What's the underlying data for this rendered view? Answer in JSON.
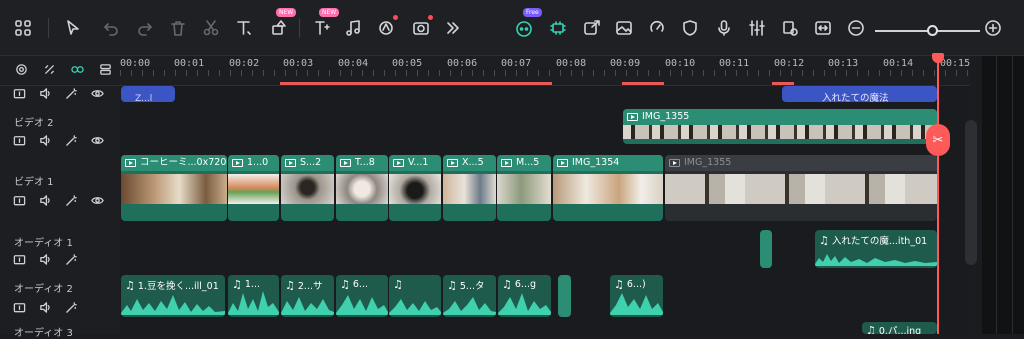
{
  "toolbar": {
    "badges": {
      "new1": "NEW",
      "new2": "NEW",
      "free": "Free"
    },
    "icons": [
      "grid-icon",
      "pointer-icon",
      "undo-icon",
      "redo-icon",
      "delete-icon",
      "cut-icon",
      "text-icon",
      "crop-icon",
      "text-effect-icon",
      "music-plus-icon",
      "auto-icon",
      "camera-icon",
      "more-icon",
      "ai-copilot-icon",
      "chip-icon",
      "export-frame-icon",
      "image-icon",
      "speed-icon",
      "shield-icon",
      "microphone-icon",
      "mixer-icon",
      "preview-icon",
      "fit-icon",
      "zoom-out-icon",
      "zoom-in-icon"
    ],
    "zoom_level": 0.55
  },
  "ruler": {
    "ticks": [
      "00:00",
      "00:01",
      "00:02",
      "00:03",
      "00:04",
      "00:05",
      "00:06",
      "00:07",
      "00:08",
      "00:09",
      "00:10",
      "00:11",
      "00:12",
      "00:13",
      "00:14",
      "00:15"
    ]
  },
  "tracks": {
    "video2": {
      "label": "ビデオ 2"
    },
    "video1": {
      "label": "ビデオ 1"
    },
    "audio1": {
      "label": "オーディオ 1"
    },
    "audio2": {
      "label": "オーディオ 2"
    },
    "audio3": {
      "label": "オーディオ 3"
    }
  },
  "clips": {
    "top_left": "Z...l",
    "top_right": "入れたての魔法",
    "video2_img": "IMG_1355",
    "video1": [
      {
        "label": "コーヒーミ...0x720"
      },
      {
        "label": "1...0"
      },
      {
        "label": "S...2"
      },
      {
        "label": "T...8"
      },
      {
        "label": "V...1"
      },
      {
        "label": "X...5"
      },
      {
        "label": "M...5"
      },
      {
        "label": "IMG_1354"
      },
      {
        "label": "IMG_1355"
      }
    ],
    "audio1_clip": "入れたての魔...ith_01",
    "audio2": [
      {
        "label": "1.豆を挽く...ill_01"
      },
      {
        "label": "1..."
      },
      {
        "label": "2...サ"
      },
      {
        "label": "6..."
      },
      {
        "label": ""
      },
      {
        "label": "5...タ"
      },
      {
        "label": "6...g"
      },
      {
        "label": "6...)"
      }
    ],
    "audio3_clip": "0.パ...ing"
  },
  "colors": {
    "accent": "#2a8d74",
    "playhead": "#ff5a5a",
    "title_clip": "#3b55c4"
  }
}
